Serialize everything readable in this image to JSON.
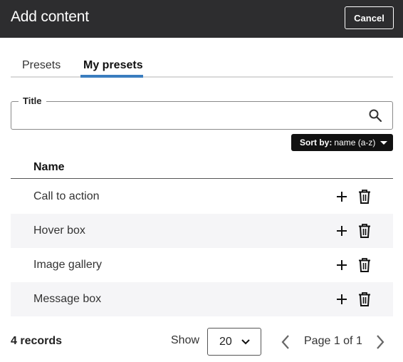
{
  "header": {
    "title": "Add content",
    "cancel_label": "Cancel"
  },
  "tabs": [
    {
      "label": "Presets",
      "active": false
    },
    {
      "label": "My presets",
      "active": true
    }
  ],
  "accent_color": "#3a7dbf",
  "search": {
    "label": "Title",
    "value": "",
    "placeholder": ""
  },
  "sort": {
    "prefix": "Sort by:",
    "value": "name (a-z)"
  },
  "table": {
    "column_header": "Name",
    "rows": [
      {
        "name": "Call to action"
      },
      {
        "name": "Hover box"
      },
      {
        "name": "Image gallery"
      },
      {
        "name": "Message box"
      }
    ],
    "row_icons": [
      "plus-icon",
      "trash-icon"
    ]
  },
  "footer": {
    "records": "4 records",
    "show_label": "Show",
    "page_size": "20",
    "page_text": "Page 1 of 1"
  }
}
